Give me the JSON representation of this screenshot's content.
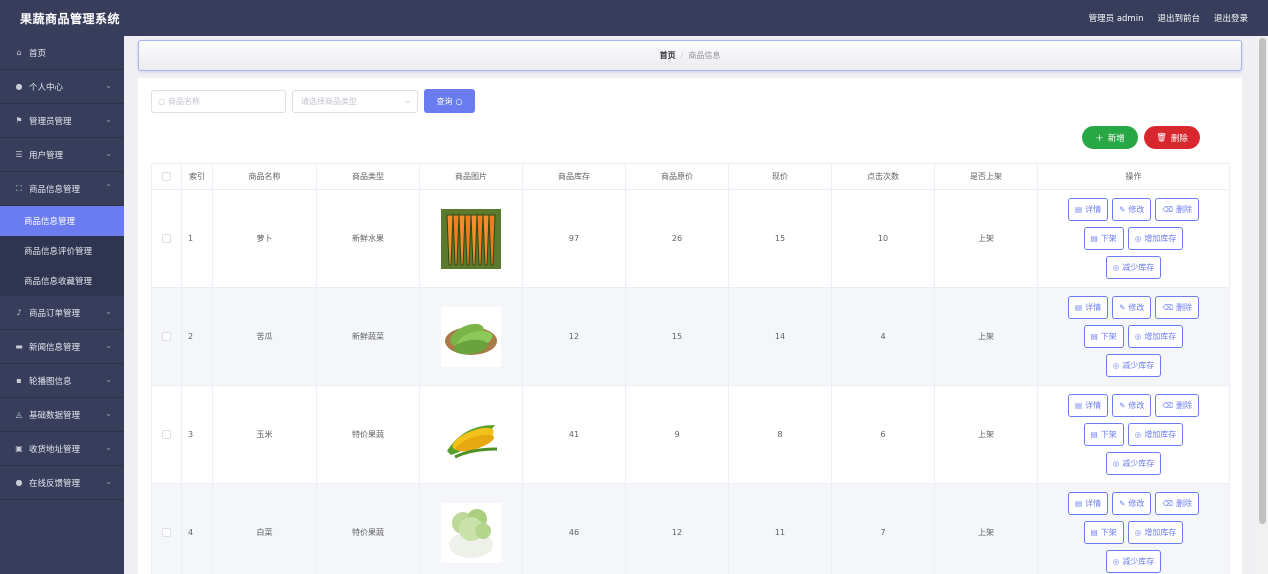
{
  "header": {
    "title": "果蔬商品管理系统",
    "links": [
      "管理员 admin",
      "退出到前台",
      "退出登录"
    ]
  },
  "sidebar": {
    "items": [
      {
        "label": "首页",
        "icon": "home-icon"
      },
      {
        "label": "个人中心",
        "icon": "user-icon"
      },
      {
        "label": "管理员管理",
        "icon": "flag-icon"
      },
      {
        "label": "用户管理",
        "icon": "sliders-icon"
      },
      {
        "label": "商品信息管理",
        "icon": "expand-icon",
        "expanded": true,
        "children": [
          {
            "label": "商品信息管理",
            "active": true
          },
          {
            "label": "商品信息评价管理"
          },
          {
            "label": "商品信息收藏管理"
          }
        ]
      },
      {
        "label": "商品订单管理",
        "icon": "mic-icon"
      },
      {
        "label": "新闻信息管理",
        "icon": "film-icon"
      },
      {
        "label": "轮播图信息",
        "icon": "message-icon"
      },
      {
        "label": "基础数据管理",
        "icon": "bell-icon"
      },
      {
        "label": "收货地址管理",
        "icon": "clipboard-icon"
      },
      {
        "label": "在线反馈管理",
        "icon": "person-icon"
      }
    ]
  },
  "breadcrumb": {
    "home": "首页",
    "separator": "/",
    "current": "商品信息"
  },
  "search": {
    "name_placeholder": "商品名称",
    "type_placeholder": "请选择商品类型",
    "query_label": "查询"
  },
  "actions": {
    "add_label": "新增",
    "delete_label": "删除"
  },
  "table": {
    "headers": [
      "索引",
      "商品名称",
      "商品类型",
      "商品图片",
      "商品库存",
      "商品原价",
      "现价",
      "点击次数",
      "是否上架",
      "操作"
    ],
    "rows": [
      {
        "index": "1",
        "name": "萝卜",
        "type": "新鲜水果",
        "image": "carrot",
        "stock": "97",
        "original": "26",
        "price": "15",
        "clicks": "10",
        "status": "上架"
      },
      {
        "index": "2",
        "name": "苦瓜",
        "type": "新鲜蔬菜",
        "image": "bitter-gourd",
        "stock": "12",
        "original": "15",
        "price": "14",
        "clicks": "4",
        "status": "上架"
      },
      {
        "index": "3",
        "name": "玉米",
        "type": "特价果蔬",
        "image": "corn",
        "stock": "41",
        "original": "9",
        "price": "8",
        "clicks": "6",
        "status": "上架"
      },
      {
        "index": "4",
        "name": "白菜",
        "type": "特价果蔬",
        "image": "cabbage",
        "stock": "46",
        "original": "12",
        "price": "11",
        "clicks": "7",
        "status": "上架"
      }
    ],
    "row_ops": {
      "detail": "详情",
      "edit": "修改",
      "delete": "删除",
      "offshelf": "下架",
      "add_stock": "增加库存",
      "reduce_stock": "减少库存"
    }
  },
  "colors": {
    "header_bg": "#373d5b",
    "accent": "#6b7cf0",
    "add_green": "#28a745",
    "delete_red": "#d9272e"
  }
}
